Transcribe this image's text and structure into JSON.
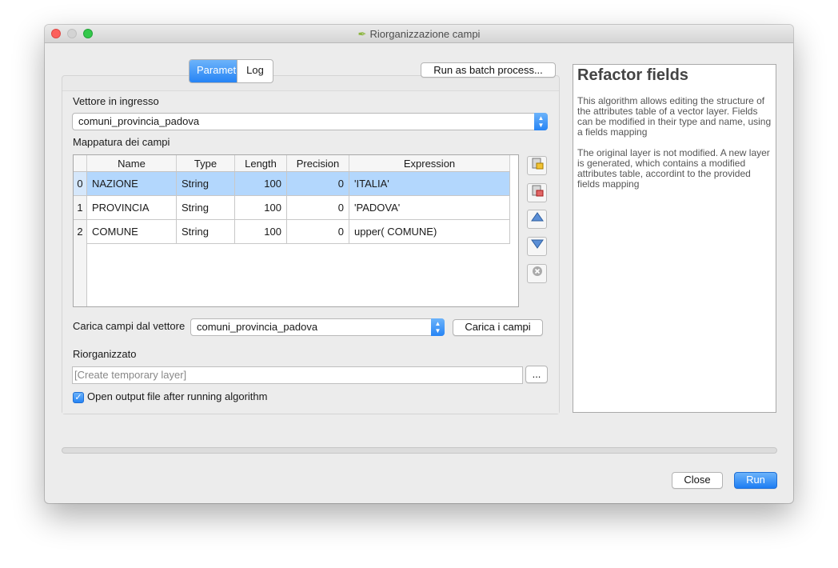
{
  "window": {
    "title": "Riorganizzazione campi"
  },
  "tabs": {
    "params": "Parametri",
    "log": "Log"
  },
  "batch_button": "Run as batch process...",
  "input_vector": {
    "label": "Vettore in ingresso",
    "value": "comuni_provincia_padova"
  },
  "field_mapping": {
    "label": "Mappatura dei campi",
    "columns": [
      "Name",
      "Type",
      "Length",
      "Precision",
      "Expression"
    ],
    "rows": [
      {
        "index": "0",
        "name": "NAZIONE",
        "type": "String",
        "length": "100",
        "precision": "0",
        "expression": "'ITALIA'"
      },
      {
        "index": "1",
        "name": "PROVINCIA",
        "type": "String",
        "length": "100",
        "precision": "0",
        "expression": "'PADOVA'"
      },
      {
        "index": "2",
        "name": "COMUNE",
        "type": "String",
        "length": "100",
        "precision": "0",
        "expression": " upper( COMUNE)"
      }
    ],
    "selected_row": 0
  },
  "load_fields": {
    "label": "Carica campi dal vettore",
    "value": "comuni_provincia_padova",
    "button": "Carica i campi"
  },
  "output": {
    "label": "Riorganizzato",
    "placeholder": "[Create temporary layer]",
    "browse": "..."
  },
  "open_output": {
    "label": "Open output file after running algorithm",
    "checked": true
  },
  "help": {
    "title": "Refactor fields",
    "p1": "This algorithm allows editing the structure of the attributes table of a vector layer. Fields can be modified in their type and name, using a fields mapping",
    "p2": "The original layer is not modified. A new layer is generated, which contains a modified attributes table, accordint to the provided fields mapping"
  },
  "progress": 0,
  "buttons": {
    "close": "Close",
    "run": "Run"
  },
  "colors": {
    "accent": "#2684f5",
    "selection": "#b3d7fd"
  }
}
